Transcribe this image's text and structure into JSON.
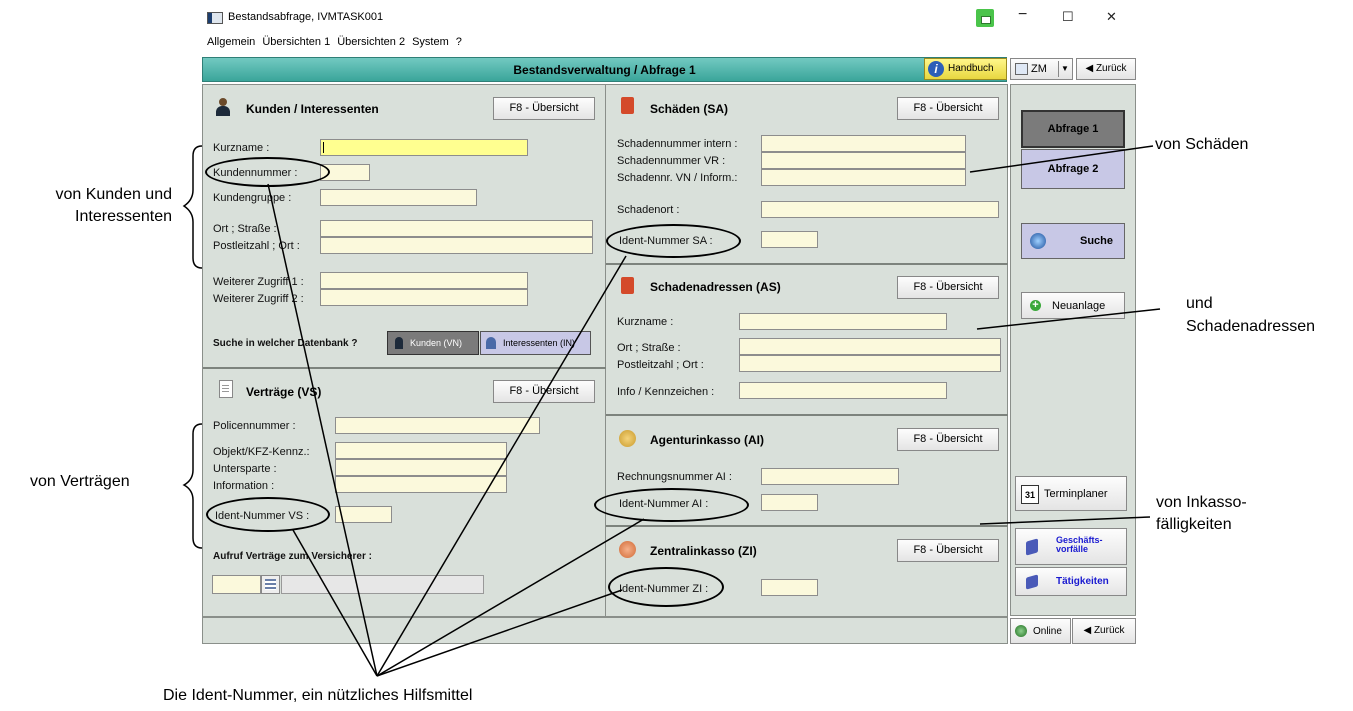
{
  "window": {
    "title": "Bestandsabfrage, IVMTASK001",
    "menu": [
      "Allgemein",
      "Übersichten 1",
      "Übersichten 2",
      "System",
      "?"
    ],
    "controls": {
      "minimize": "−",
      "maximize": "☐",
      "close": "✕"
    }
  },
  "header": {
    "title": "Bestandsverwaltung / Abfrage  1",
    "handbuch": "Handbuch",
    "zm": "ZM",
    "zurueck": "◀ Zurück"
  },
  "kunden": {
    "title": "Kunden / Interessenten",
    "f8": "F8 - Übersicht",
    "labels": {
      "kurzname": "Kurzname :",
      "kundennummer": "Kundennummer :",
      "kundengruppe": "Kundengruppe :",
      "ort": "Ort ; Straße :",
      "plz": "Postleitzahl ; Ort :",
      "zugriff1": "Weiterer Zugriff 1 :",
      "zugriff2": "Weiterer Zugriff 2 :"
    },
    "db_question": "Suche in welcher Datenbank ?",
    "db_kunden": "Kunden (VN)",
    "db_interessenten": "Interessenten (IN)"
  },
  "vertraege": {
    "title": "Verträge (VS)",
    "f8": "F8 - Übersicht",
    "labels": {
      "police": "Policennummer :",
      "objekt": "Objekt/KFZ-Kennz.:",
      "untersparte": "Untersparte :",
      "information": "Information :",
      "ident": "Ident-Nummer VS :"
    },
    "aufruf": "Aufruf Verträge zum Versicherer :"
  },
  "schaeden": {
    "title": "Schäden (SA)",
    "f8": "F8 - Übersicht",
    "labels": {
      "intern": "Schadennummer intern :",
      "vr": "Schadennummer VR :",
      "vn": "Schadennr. VN / Inform.:",
      "ort": "Schadenort :",
      "ident": "Ident-Nummer SA :"
    }
  },
  "adressen": {
    "title": "Schadenadressen (AS)",
    "f8": "F8 - Übersicht",
    "labels": {
      "kurzname": "Kurzname :",
      "ort": "Ort ; Straße :",
      "plz": "Postleitzahl ; Ort :",
      "info": "Info / Kennzeichen :"
    }
  },
  "agentur": {
    "title": "Agenturinkasso (AI)",
    "f8": "F8 - Übersicht",
    "labels": {
      "rechnung": "Rechnungsnummer AI :",
      "ident": "Ident-Nummer AI :"
    }
  },
  "zentral": {
    "title": "Zentralinkasso (ZI)",
    "f8": "F8 - Übersicht",
    "labels": {
      "ident": "Ident-Nummer ZI :"
    }
  },
  "sidebar": {
    "abfrage1": "Abfrage 1",
    "abfrage2": "Abfrage 2",
    "suche": "Suche",
    "neuanlage": "Neuanlage",
    "terminplaner": "Terminplaner",
    "terminplaner_day": "31",
    "geschaeft": "Geschäfts-vorfälle",
    "taetigkeiten": "Tätigkeiten",
    "online": "Online",
    "zurueck": "◀ Zurück"
  },
  "annotations": {
    "kunden": "von Kunden und Interessenten",
    "vertraege": "von Verträgen",
    "schaeden": "von Schäden",
    "adressen": "und Schadenadressen",
    "inkasso": "von Inkasso-fälligkeiten",
    "bottom": "Die Ident-Nummer, ein nützliches Hilfsmittel"
  },
  "colors": {
    "teal": "#3aa59a",
    "panel": "#d9e0da",
    "field": "#fbf9dc",
    "active_field": "#ffff90",
    "sidebar_active": "#7b7b7b",
    "sidebar_button": "#c8c8e6"
  }
}
